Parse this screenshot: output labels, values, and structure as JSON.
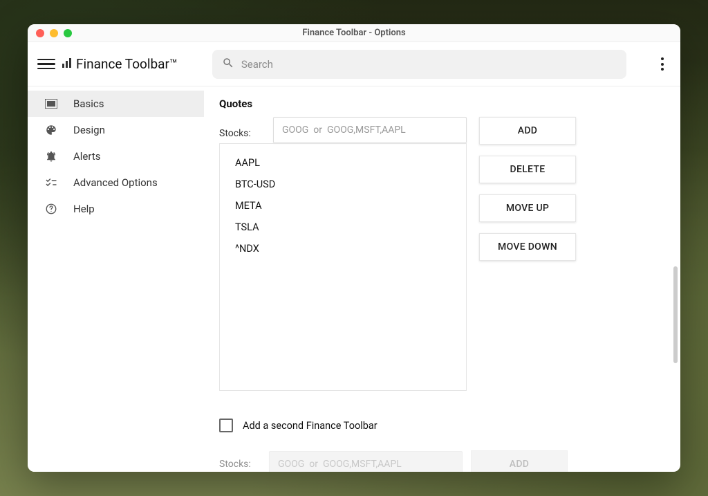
{
  "window": {
    "title": "Finance Toolbar - Options"
  },
  "header": {
    "logo": "Finance Toolbar™",
    "search_placeholder": "Search"
  },
  "sidebar": {
    "items": [
      {
        "label": "Basics",
        "active": true
      },
      {
        "label": "Design",
        "active": false
      },
      {
        "label": "Alerts",
        "active": false
      },
      {
        "label": "Advanced Options",
        "active": false
      },
      {
        "label": "Help",
        "active": false
      }
    ]
  },
  "quotes": {
    "section_title": "Quotes",
    "stocks_label": "Stocks:",
    "input_placeholder": "GOOG  or  GOOG,MSFT,AAPL",
    "list": [
      "AAPL",
      "BTC-USD",
      "META",
      "TSLA",
      "^NDX"
    ],
    "buttons": {
      "add": "ADD",
      "delete": "DELETE",
      "up": "MOVE UP",
      "down": "MOVE DOWN"
    }
  },
  "second_toolbar": {
    "checkbox_label": "Add a second Finance Toolbar",
    "checked": false,
    "stocks_label": "Stocks:",
    "input_placeholder": "GOOG  or  GOOG,MSFT,AAPL",
    "add_label": "ADD"
  }
}
